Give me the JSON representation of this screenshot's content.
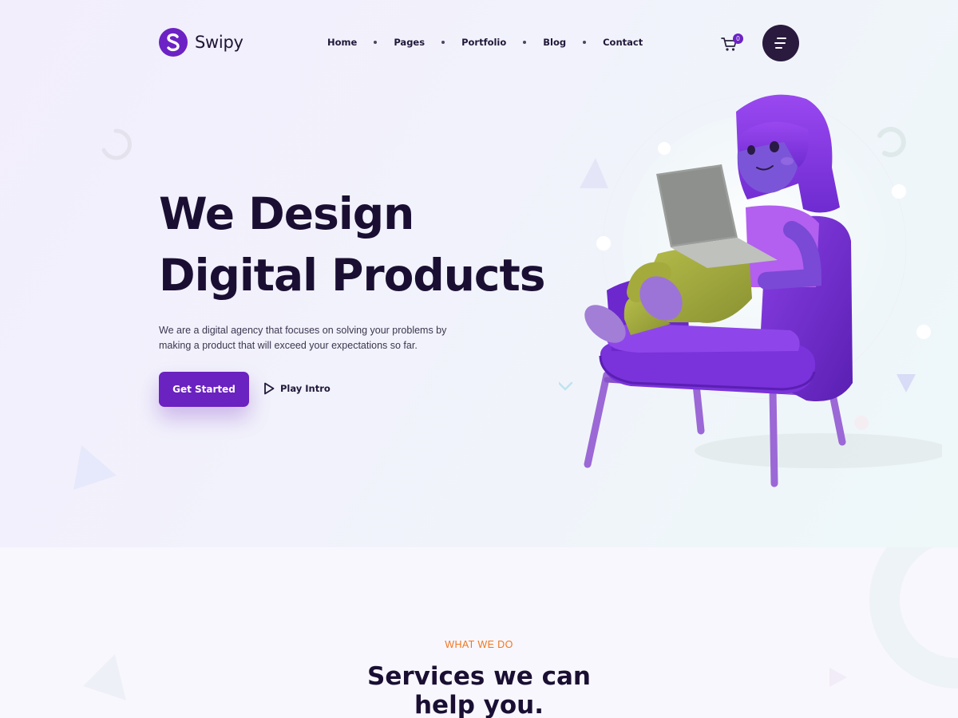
{
  "brand": {
    "name": "Swipy",
    "accent": "#6a22c0",
    "dark": "#2a1a3e",
    "eyebrow_color": "#f2761f"
  },
  "nav": {
    "items": [
      {
        "label": "Home"
      },
      {
        "label": "Pages"
      },
      {
        "label": "Portfolio"
      },
      {
        "label": "Blog"
      },
      {
        "label": "Contact"
      }
    ]
  },
  "header": {
    "cart_icon": "cart-icon",
    "cart_count": "0",
    "menu_icon": "hamburger-menu-icon"
  },
  "hero": {
    "headline_line1": "We Design",
    "headline_line2": "Digital Products",
    "description": "We are a digital agency that focuses on solving your problems by making a product that will exceed your expectations so far.",
    "cta_label": "Get Started",
    "play_label": "Play Intro",
    "play_icon": "play-icon",
    "illustration": "girl-in-armchair-with-laptop-illustration"
  },
  "services": {
    "eyebrow": "WHAT WE DO",
    "title_line1": "Services we can",
    "title_line2": "help you."
  }
}
